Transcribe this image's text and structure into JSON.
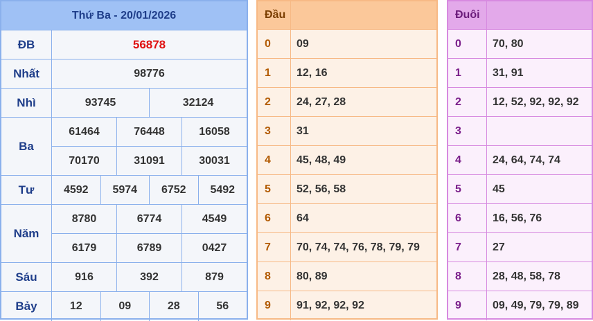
{
  "results": {
    "title": "Thứ Ba - 20/01/2026",
    "prizes": [
      {
        "label": "ĐB",
        "lines": [
          [
            "56878"
          ]
        ]
      },
      {
        "label": "Nhất",
        "lines": [
          [
            "98776"
          ]
        ]
      },
      {
        "label": "Nhì",
        "lines": [
          [
            "93745",
            "32124"
          ]
        ]
      },
      {
        "label": "Ba",
        "lines": [
          [
            "61464",
            "76448",
            "16058"
          ],
          [
            "70170",
            "31091",
            "30031"
          ]
        ]
      },
      {
        "label": "Tư",
        "lines": [
          [
            "4592",
            "5974",
            "6752",
            "5492"
          ]
        ]
      },
      {
        "label": "Năm",
        "lines": [
          [
            "8780",
            "6774",
            "4549"
          ],
          [
            "6179",
            "6789",
            "0427"
          ]
        ]
      },
      {
        "label": "Sáu",
        "lines": [
          [
            "916",
            "392",
            "879"
          ]
        ]
      },
      {
        "label": "Bảy",
        "lines": [
          [
            "12",
            "09",
            "28",
            "56"
          ]
        ]
      }
    ]
  },
  "dau": {
    "header": "Đầu",
    "rows": [
      {
        "key": "0",
        "value": "09"
      },
      {
        "key": "1",
        "value": "12, 16"
      },
      {
        "key": "2",
        "value": "24, 27, 28"
      },
      {
        "key": "3",
        "value": "31"
      },
      {
        "key": "4",
        "value": "45, 48, 49"
      },
      {
        "key": "5",
        "value": "52, 56, 58"
      },
      {
        "key": "6",
        "value": "64"
      },
      {
        "key": "7",
        "value": "70, 74, 74, 76, 78, 79, 79"
      },
      {
        "key": "8",
        "value": "80, 89"
      },
      {
        "key": "9",
        "value": "91, 92, 92, 92"
      }
    ]
  },
  "duoi": {
    "header": "Đuôi",
    "rows": [
      {
        "key": "0",
        "value": "70, 80"
      },
      {
        "key": "1",
        "value": "31, 91"
      },
      {
        "key": "2",
        "value": "12, 52, 92, 92, 92"
      },
      {
        "key": "3",
        "value": ""
      },
      {
        "key": "4",
        "value": "24, 64, 74, 74"
      },
      {
        "key": "5",
        "value": "45"
      },
      {
        "key": "6",
        "value": "16, 56, 76"
      },
      {
        "key": "7",
        "value": "27"
      },
      {
        "key": "8",
        "value": "28, 48, 58, 78"
      },
      {
        "key": "9",
        "value": "09, 49, 79, 79, 89"
      }
    ]
  },
  "colors": {
    "special_prize": "#e01010",
    "results_border": "#8ab0ec",
    "dau_border": "#f7b985",
    "duoi_border": "#d78ae0"
  }
}
